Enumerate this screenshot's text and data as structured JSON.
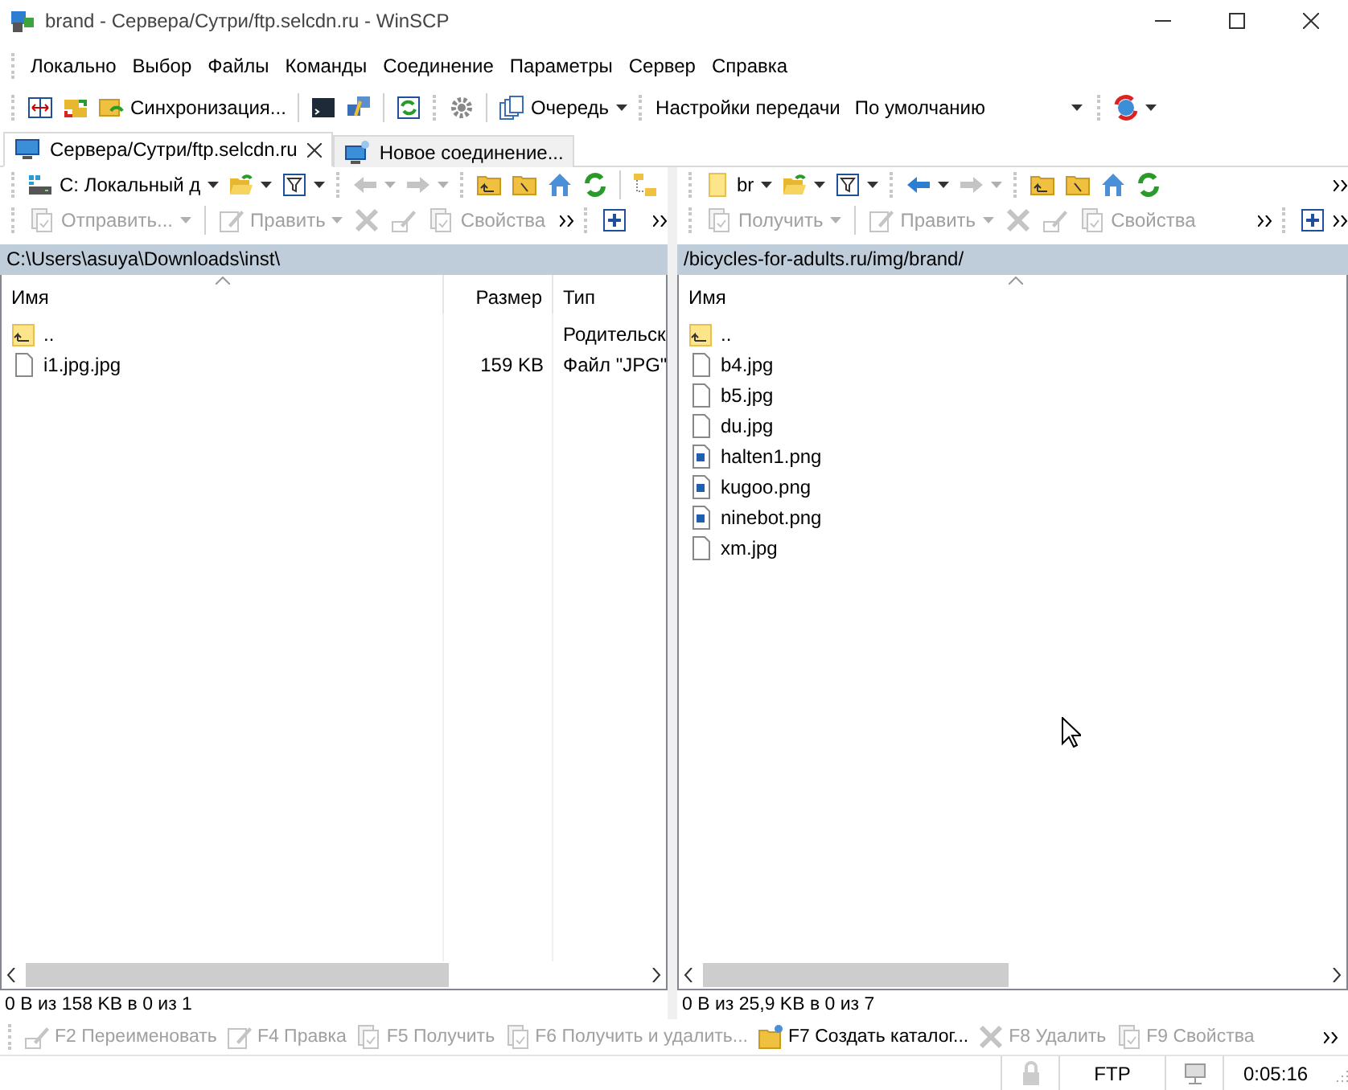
{
  "window": {
    "title": "brand - Сервера/Сутри/ftp.selcdn.ru - WinSCP"
  },
  "menu": [
    "Локально",
    "Выбор",
    "Файлы",
    "Команды",
    "Соединение",
    "Параметры",
    "Сервер",
    "Справка"
  ],
  "toolbar": {
    "sync_label": "Синхронизация...",
    "queue_label": "Очередь",
    "transfer_label": "Настройки передачи",
    "transfer_preset": "По умолчанию"
  },
  "tabs": [
    {
      "label": "Сервера/Сутри/ftp.selcdn.ru",
      "selected": true,
      "kind": "session"
    },
    {
      "label": "Новое соединение...",
      "selected": false,
      "kind": "new"
    }
  ],
  "panels": [
    {
      "location": "C: Локальный д",
      "kind": "drive",
      "back": {
        "disabled": true
      },
      "forward": {
        "disabled": true
      },
      "actions": [
        {
          "kind": "split",
          "label": "Отправить...",
          "disabled": true
        },
        {
          "kind": "split",
          "label": "Править",
          "disabled": true
        },
        {
          "kind": "delete",
          "disabled": true
        },
        {
          "kind": "rename",
          "disabled": true
        },
        {
          "kind": "plain",
          "label": "Свойства",
          "disabled": true
        }
      ],
      "path": "C:\\Users\\asuya\\Downloads\\inst\\",
      "columns": [
        "Имя",
        "Размер",
        "Тип"
      ],
      "rows": [
        {
          "kind": "parent",
          "name": "..",
          "type": "Родительск"
        },
        {
          "kind": "file",
          "name": "i1.jpg.jpg",
          "size": "159 KB",
          "type": "Файл \"JPG\""
        }
      ],
      "status": "0 B из 158 KB в 0 из 1"
    },
    {
      "location": "br",
      "kind": "folder",
      "back": {
        "disabled": false
      },
      "forward": {
        "disabled": true
      },
      "actions": [
        {
          "kind": "split",
          "label": "Получить",
          "disabled": true
        },
        {
          "kind": "split",
          "label": "Править",
          "disabled": true
        },
        {
          "kind": "delete",
          "disabled": true
        },
        {
          "kind": "rename",
          "disabled": true
        },
        {
          "kind": "plain",
          "label": "Свойства",
          "disabled": true
        }
      ],
      "path": "/bicycles-for-adults.ru/img/brand/",
      "columns": [
        "Имя"
      ],
      "rows": [
        {
          "kind": "parent",
          "name": ".."
        },
        {
          "kind": "file",
          "name": "b4.jpg"
        },
        {
          "kind": "file",
          "name": "b5.jpg"
        },
        {
          "kind": "file",
          "name": "du.jpg"
        },
        {
          "kind": "image",
          "name": "halten1.png"
        },
        {
          "kind": "image",
          "name": "kugoo.png"
        },
        {
          "kind": "image",
          "name": "ninebot.png"
        },
        {
          "kind": "file",
          "name": "xm.jpg"
        }
      ],
      "status": "0 B из 25,9 KB в 0 из 7"
    }
  ],
  "function_keys": [
    {
      "kind": "rename",
      "label": "F2 Переименовать",
      "disabled": true
    },
    {
      "kind": "edit",
      "label": "F4 Правка",
      "disabled": true
    },
    {
      "kind": "download",
      "label": "F5 Получить",
      "disabled": true
    },
    {
      "kind": "download",
      "label": "F6 Получить и удалить...",
      "disabled": true
    },
    {
      "kind": "newfolder",
      "label": "F7 Создать каталог...",
      "disabled": false
    },
    {
      "kind": "delete",
      "label": "F8 Удалить",
      "disabled": true
    },
    {
      "kind": "properties",
      "label": "F9 Свойства",
      "disabled": true
    }
  ],
  "status_bar": {
    "protocol": "FTP",
    "time": "0:05:16"
  }
}
